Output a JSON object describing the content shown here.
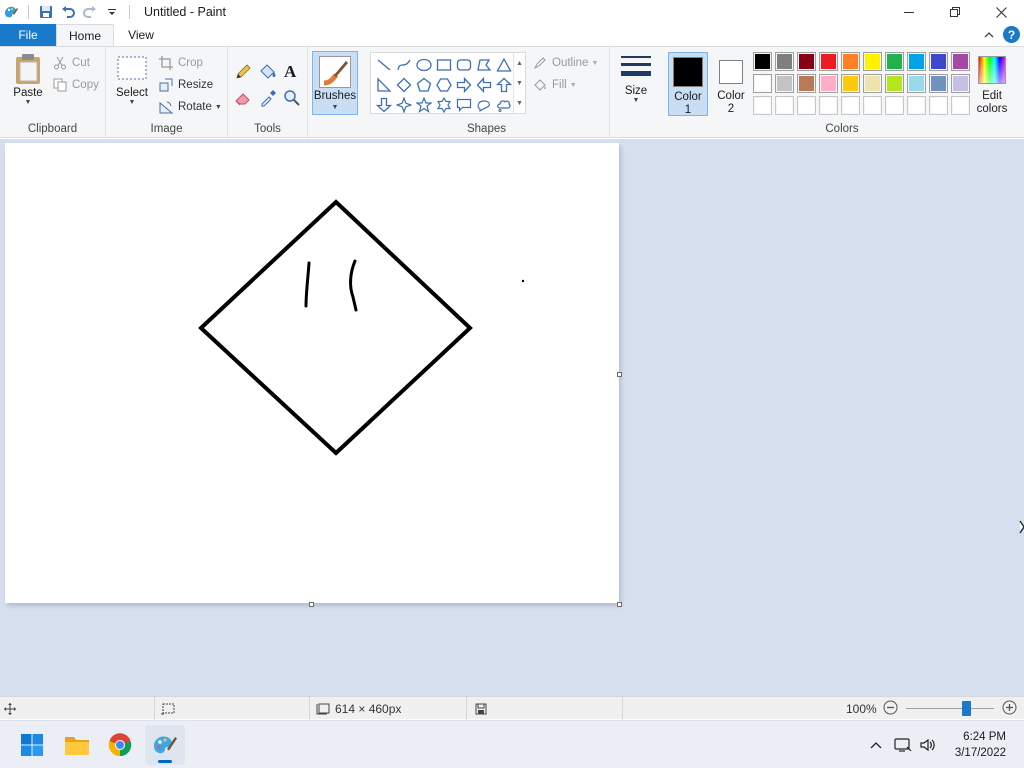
{
  "window": {
    "title": "Untitled - Paint"
  },
  "tabs": [
    {
      "label": "File"
    },
    {
      "label": "Home"
    },
    {
      "label": "View"
    }
  ],
  "help_label": "?",
  "clipboard": {
    "paste": "Paste",
    "cut": "Cut",
    "copy": "Copy",
    "group": "Clipboard"
  },
  "image": {
    "select": "Select",
    "crop": "Crop",
    "resize": "Resize",
    "rotate": "Rotate",
    "group": "Image"
  },
  "tools": {
    "group": "Tools",
    "text_glyph": "A"
  },
  "brushes": {
    "label": "Brushes"
  },
  "shapes": {
    "outline": "Outline",
    "fill": "Fill",
    "group": "Shapes"
  },
  "size": {
    "label": "Size"
  },
  "colors": {
    "color1_label": "Color",
    "color1_num": "1",
    "color2_label": "Color",
    "color2_num": "2",
    "edit_label": "Edit",
    "edit_label2": "colors",
    "group": "Colors",
    "color1_value": "#000000",
    "color2_value": "#ffffff",
    "palette_row1": [
      "#000000",
      "#7f7f7f",
      "#880015",
      "#ed1c24",
      "#ff7f27",
      "#fff200",
      "#22b14c",
      "#00a2e8",
      "#3f48cc",
      "#a349a4"
    ],
    "palette_row2": [
      "#ffffff",
      "#c3c3c3",
      "#b97a57",
      "#ffaec9",
      "#ffc90e",
      "#efe4b0",
      "#b5e61d",
      "#99d9ea",
      "#7092be",
      "#c8bfe7"
    ],
    "palette_row3": [
      "#ffffff",
      "#ffffff",
      "#ffffff",
      "#ffffff",
      "#ffffff",
      "#ffffff",
      "#ffffff",
      "#ffffff",
      "#ffffff",
      "#ffffff"
    ]
  },
  "status": {
    "dimensions": "614 × 460px",
    "zoom": "100%",
    "zoom_fraction": 0.71
  },
  "taskbar": {
    "time": "6:24 PM",
    "date": "3/17/2022"
  }
}
